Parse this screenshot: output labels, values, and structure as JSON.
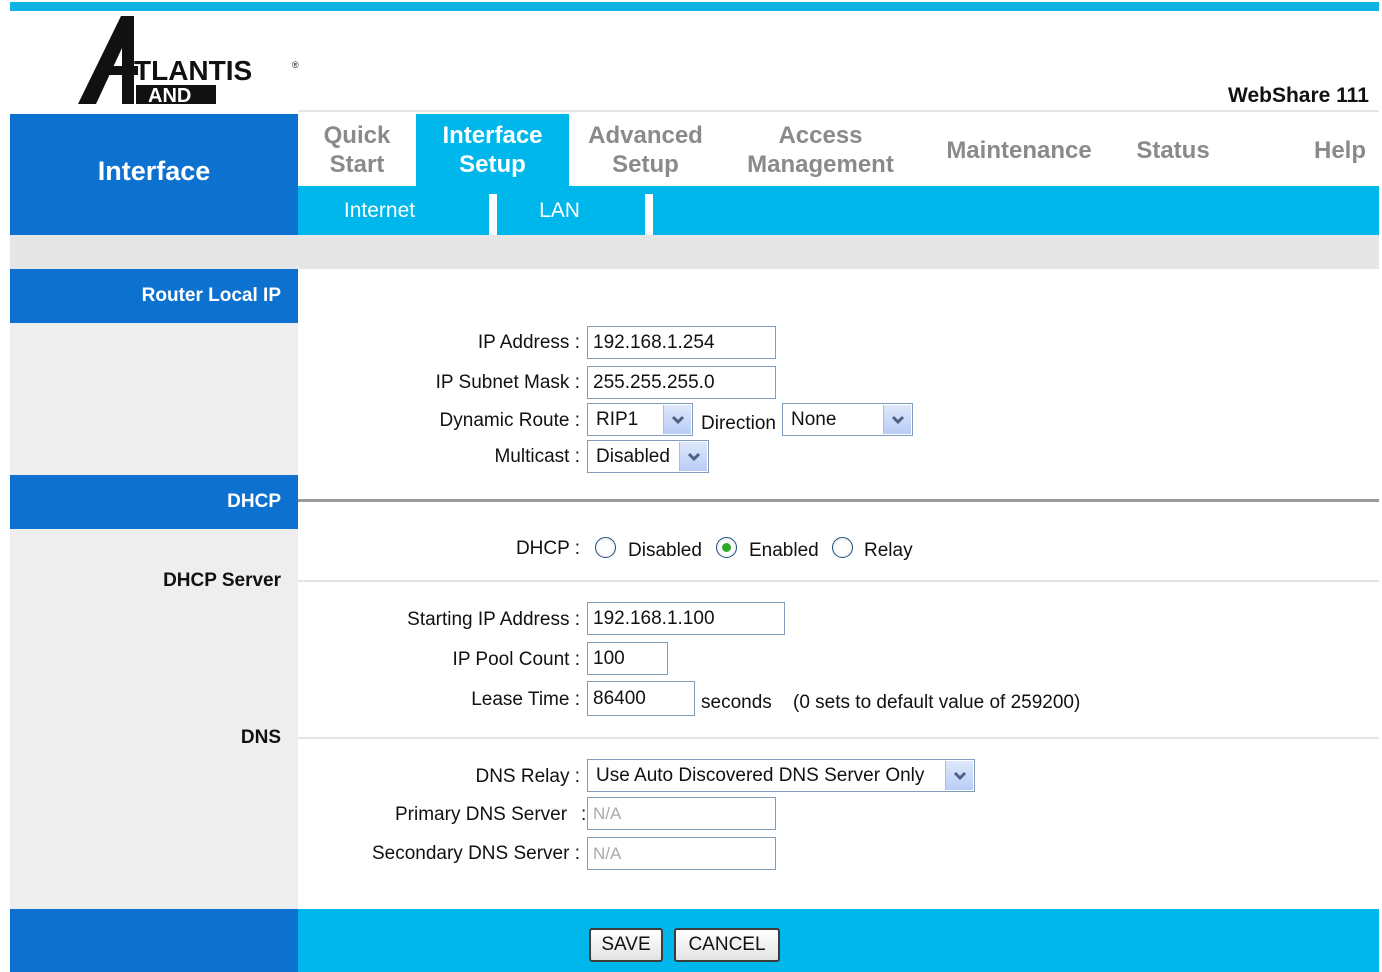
{
  "header": {
    "logo_text_top": "TLANTIS",
    "logo_text_bottom": "AND",
    "product_name": "WebShare 111"
  },
  "nav": {
    "section_title": "Interface",
    "items": [
      {
        "label_line1": "Quick",
        "label_line2": "Start",
        "active": false
      },
      {
        "label_line1": "Interface",
        "label_line2": "Setup",
        "active": true
      },
      {
        "label_line1": "Advanced",
        "label_line2": "Setup",
        "active": false
      },
      {
        "label_line1": "Access",
        "label_line2": "Management",
        "active": false
      },
      {
        "label_line1": "Maintenance",
        "label_line2": "",
        "active": false
      },
      {
        "label_line1": "Status",
        "label_line2": "",
        "active": false
      },
      {
        "label_line1": "Help",
        "label_line2": "",
        "active": false
      }
    ],
    "subitems": [
      "Internet",
      "LAN"
    ]
  },
  "sections": {
    "router_local_ip": "Router Local IP",
    "dhcp": "DHCP",
    "dhcp_server": "DHCP Server",
    "dns": "DNS"
  },
  "router": {
    "ip_address_label": "IP Address :",
    "ip_address": "192.168.1.254",
    "subnet_label": "IP Subnet Mask :",
    "subnet": "255.255.255.0",
    "dynamic_route_label": "Dynamic Route :",
    "dynamic_route": "RIP1",
    "direction_label": "Direction",
    "direction": "None",
    "multicast_label": "Multicast :",
    "multicast": "Disabled"
  },
  "dhcp": {
    "label": "DHCP :",
    "options": [
      "Disabled",
      "Enabled",
      "Relay"
    ],
    "selected": "Enabled",
    "start_ip_label": "Starting IP Address :",
    "start_ip": "192.168.1.100",
    "pool_label": "IP Pool Count :",
    "pool": "100",
    "lease_label": "Lease Time :",
    "lease": "86400",
    "lease_unit": "seconds",
    "lease_note": "(0 sets to default value of 259200)"
  },
  "dns": {
    "relay_label": "DNS Relay :",
    "relay": "Use Auto Discovered DNS Server Only",
    "primary_label": "Primary DNS Server",
    "primary_colon": ":",
    "primary": "N/A",
    "secondary_label": "Secondary DNS Server :",
    "secondary": "N/A"
  },
  "buttons": {
    "save": "SAVE",
    "cancel": "CANCEL"
  },
  "colors": {
    "dark_blue": "#0d71cf",
    "light_blue": "#00b7ec",
    "gray": "#eeeeee"
  }
}
